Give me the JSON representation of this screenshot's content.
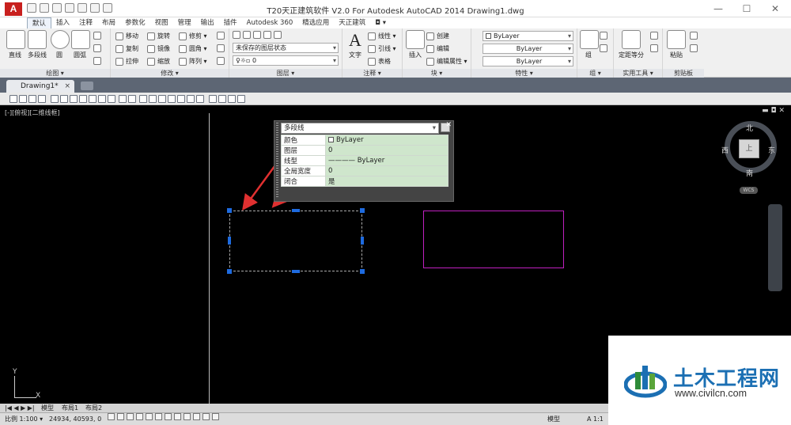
{
  "title_bar": {
    "window_title": "T20天正建筑软件 V2.0 For Autodesk AutoCAD 2014     Drawing1.dwg",
    "logo_letter": "A",
    "minimize": "—",
    "maximize": "☐",
    "close": "✕"
  },
  "ribbon_tabs": [
    "默认",
    "插入",
    "注释",
    "布局",
    "参数化",
    "视图",
    "管理",
    "输出",
    "插件",
    "Autodesk 360",
    "精选应用",
    "天正建筑",
    "◘ ▾"
  ],
  "ribbon": {
    "draw": {
      "title": "绘图 ▾",
      "line": "直线",
      "polyline": "多段线",
      "circle": "圆",
      "arc": "圆弧"
    },
    "modify": {
      "title": "修改 ▾",
      "move": "移动",
      "rotate": "旋转",
      "trim": "修剪 ▾",
      "copy": "复制",
      "mirror": "镜像",
      "fillet": "圆角 ▾",
      "stretch": "拉伸",
      "scale": "缩放",
      "array": "阵列 ▾"
    },
    "layers": {
      "title": "图层 ▾",
      "layer_state": "未保存的图层状态",
      "current_layer": "0"
    },
    "annotation": {
      "title": "注释 ▾",
      "text": "文字",
      "linear": "线性 ▾",
      "leader": "引线 ▾",
      "table": "表格"
    },
    "block": {
      "title": "块 ▾",
      "insert": "插入",
      "create": "创建",
      "edit": "编辑",
      "edit_attr": "编辑属性 ▾"
    },
    "properties": {
      "title": "特性 ▾",
      "color": "ByLayer",
      "linetype": "ByLayer",
      "lineweight": "ByLayer"
    },
    "group": {
      "title": "组 ▾",
      "group": "组"
    },
    "utilities": {
      "title": "实用工具 ▾",
      "measure": "定距等分"
    },
    "clipboard": {
      "title": "剪贴板",
      "paste": "粘贴"
    }
  },
  "doc_tab": {
    "name": "Drawing1*",
    "close": "×"
  },
  "viewport": {
    "label": "[-][俯视][二维线框]",
    "controls": "▬ ◘ ✕"
  },
  "properties_panel": {
    "object_type": "多段线",
    "close": "✕",
    "rows": [
      {
        "key": "颜色",
        "value": "ByLayer",
        "swatch": true
      },
      {
        "key": "图层",
        "value": "0"
      },
      {
        "key": "线型",
        "value": "———— ByLayer"
      },
      {
        "key": "全局宽度",
        "value": "0"
      },
      {
        "key": "闭合",
        "value": "是"
      }
    ]
  },
  "viewcube": {
    "north": "北",
    "south": "南",
    "east": "东",
    "west": "西",
    "top": "上",
    "wcs": "WCS"
  },
  "ucs": {
    "x": "X",
    "y": "Y"
  },
  "layout_tabs": {
    "nav": "|◀ ◀ ▶ ▶|",
    "model": "模型",
    "layout1": "布局1",
    "layout2": "布局2"
  },
  "status_bar": {
    "scale": "比例 1:100 ▾",
    "coords": "24934, 40593, 0",
    "model": "模型",
    "ratio": "A 1:1"
  },
  "colors": {
    "selected_grip": "#1e6be0",
    "magenta_rect": "#c020c0",
    "arrow": "#e03030",
    "prop_value_bg": "#cfe6cc"
  },
  "watermark": {
    "name": "土木工程网",
    "url": "www.civilcn.com"
  }
}
